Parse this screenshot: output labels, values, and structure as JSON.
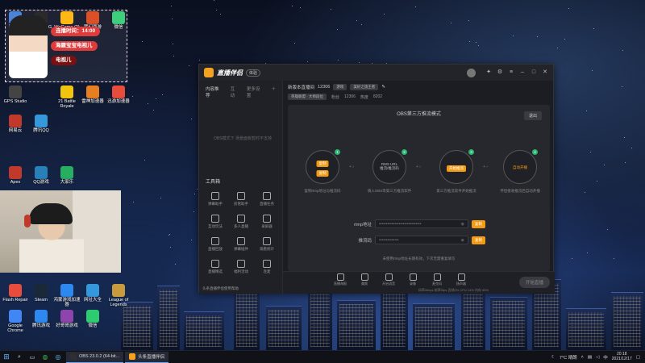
{
  "desktop_icons": [
    {
      "label": "回收站",
      "color": "#3a7bd5"
    },
    {
      "label": "Logitech G HUB",
      "color": "#1a1a1a"
    },
    {
      "label": "WeGame (2)",
      "color": "#ffb300"
    },
    {
      "label": "梦幻西游",
      "color": "#d84315"
    },
    {
      "label": "微信",
      "color": "#2ecc71"
    },
    {
      "label": "GPS Studio",
      "color": "#444"
    },
    {
      "label": "21 Battle Royale",
      "color": "#f1c40f"
    },
    {
      "label": "雷神加速器",
      "color": "#e67e22"
    },
    {
      "label": "迅游加速器",
      "color": "#e74c3c"
    },
    {
      "label": "网易云",
      "color": "#c0392b"
    },
    {
      "label": "腾讯QQ",
      "color": "#3498db"
    },
    {
      "label": "Apex",
      "color": "#c0392b"
    },
    {
      "label": "QQ游戏",
      "color": "#2980b9"
    },
    {
      "label": "大家乐",
      "color": "#27ae60"
    },
    {
      "label": "Flash Repair",
      "color": "#e74c3c"
    },
    {
      "label": "Steam",
      "color": "#1b2838"
    },
    {
      "label": "鸿蒙游戏加速器",
      "color": "#2d89ef"
    },
    {
      "label": "网址大全",
      "color": "#3498db"
    },
    {
      "label": "League of Legends",
      "color": "#c89b3c"
    },
    {
      "label": "Google Chrome",
      "color": "#4285f4"
    },
    {
      "label": "腾讯游戏",
      "color": "#2d89ef"
    },
    {
      "label": "好哥哥游戏",
      "color": "#8e44ad"
    },
    {
      "label": "微信",
      "color": "#2ecc71"
    }
  ],
  "overlay": {
    "timer_label": "连播时间：14:00",
    "badge1": "海蜃宝宝电视儿",
    "badge2": "电视儿",
    "colors": {
      "red": "#e03b3b",
      "dark": "#7a1010"
    }
  },
  "app": {
    "brand": "直播伴侣",
    "beta": "体验",
    "sidebar": {
      "tabs": [
        "内容推荐",
        "互动",
        "更多设置"
      ],
      "empty_note": "OBS模式下 场景面板暂时不支持",
      "tools_header": "工具箱",
      "tools": [
        "弹幕助手",
        "房管助手",
        "直播任务",
        "互动玩法",
        "多人直播",
        "录屏器",
        "直播回放",
        "弹幕插件",
        "观看统计",
        "直播精选",
        "福利活动",
        "连麦"
      ],
      "footer": "头条直播伴侣使用帮助"
    },
    "room": {
      "title": "新版本直播间",
      "room_id": "12306",
      "tag1": "游戏",
      "tag2": "美好之旅王者",
      "line2_label1": "英雄联盟 · 大师段位",
      "line2_label2": "粉丝",
      "line2_value2": "12306",
      "line2_label3": "热度",
      "line2_value3": "8202"
    },
    "panel": {
      "title": "OBS第三方推流模式",
      "exit": "退出",
      "steps": [
        {
          "num": "1",
          "chips": [
            "复制",
            "复制"
          ],
          "caption": "复制rtmp地址与推流码"
        },
        {
          "num": "2",
          "text": "RMS URL\n推流/推流码",
          "caption": "填入OBS等第三方推流软件"
        },
        {
          "num": "3",
          "chips": [
            "开始推流"
          ],
          "caption": "第三方推流软件开始推流"
        },
        {
          "num": "4",
          "text": "自动开播",
          "caption": "伴侣接收推流后自动开播"
        }
      ],
      "rtmp_label": "rtmp地址",
      "rtmp_value": "••••••••••••••••••••••••••••••",
      "key_label": "推流码",
      "key_value": "••••••••••••••",
      "copy": "复制",
      "hint": "未使用rtmp地址长期有效，下次无需重复填写"
    },
    "bottom": {
      "items": [
        "直播海报",
        "美颜",
        "开启语音",
        "录像",
        "麦克风",
        "扬声器"
      ],
      "start": "开始直播",
      "stats": "码率0kbps  帧率0fps  丢帧0%  CPU 14%  内存 65%"
    }
  },
  "taskbar": {
    "tasks": [
      {
        "label": "OBS 23.0.2 (64-bit...",
        "color": "#302e31"
      },
      {
        "label": "头条直播伴侣",
        "color": "#f3a320"
      }
    ],
    "weather": "7°C 晴朗",
    "lang": "中",
    "time": "20:18",
    "date": "2021/12/17"
  }
}
